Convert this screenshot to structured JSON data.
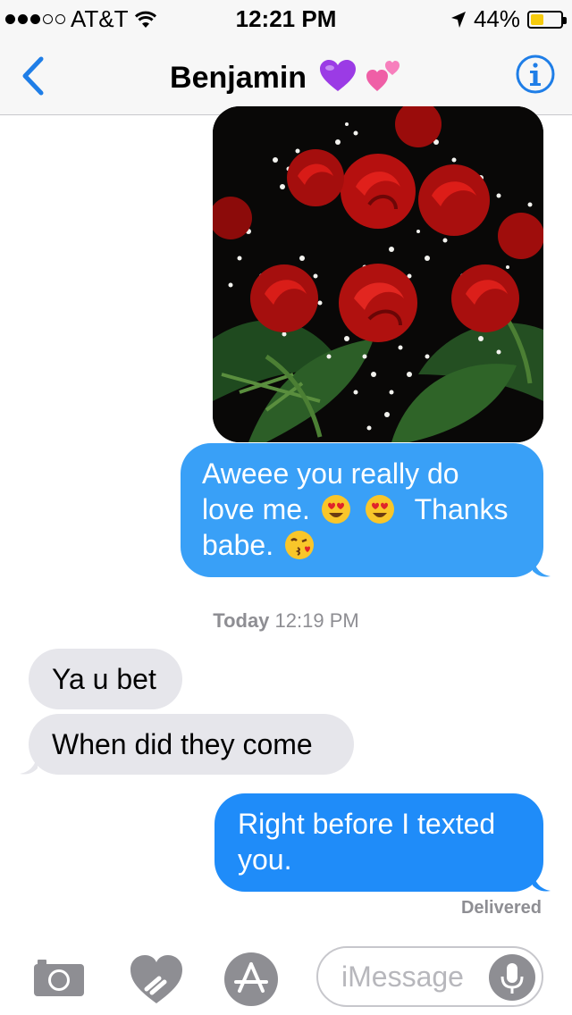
{
  "status_bar": {
    "carrier": "AT&T",
    "time": "12:21 PM",
    "battery": "44%",
    "battery_level": 0.44,
    "signal_bars_filled": 3,
    "signal_bars_total": 5
  },
  "nav": {
    "title": "Benjamin",
    "accent_color": "#1f7ee7"
  },
  "messages": {
    "photo_alt": "Red roses bouquet photo",
    "outgoing_1": {
      "line1": "Aweee you really do",
      "line2_text": "love me.",
      "line2_after": "Thanks",
      "line3": "babe."
    },
    "timestamp_day": "Today",
    "timestamp_time": "12:19 PM",
    "incoming_1": "Ya u bet",
    "incoming_2": "When did they come",
    "outgoing_2": {
      "line1": "Right before I texted",
      "line2": "you."
    },
    "delivered": "Delivered"
  },
  "input_bar": {
    "placeholder": "iMessage"
  },
  "colors": {
    "outgoing_bubble": "#1f8cf9",
    "incoming_bubble": "#e6e6eb",
    "meta_text": "#8e8e93"
  }
}
